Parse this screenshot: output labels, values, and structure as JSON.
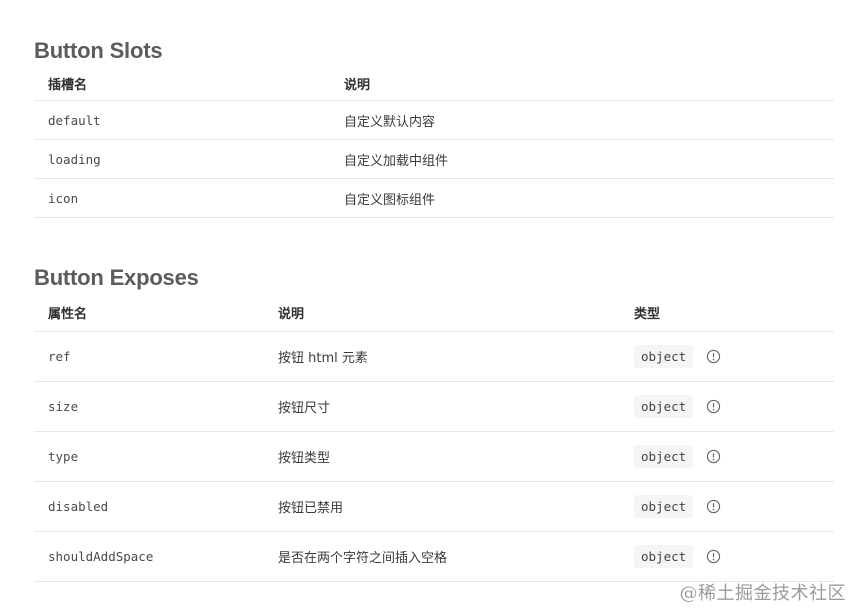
{
  "slots": {
    "title": "Button Slots",
    "headers": [
      "插槽名",
      "说明"
    ],
    "rows": [
      {
        "name": "default",
        "desc": "自定义默认内容"
      },
      {
        "name": "loading",
        "desc": "自定义加载中组件"
      },
      {
        "name": "icon",
        "desc": "自定义图标组件"
      }
    ]
  },
  "exposes": {
    "title": "Button Exposes",
    "headers": [
      "属性名",
      "说明",
      "类型"
    ],
    "rows": [
      {
        "name": "ref",
        "desc": "按钮 html 元素",
        "type": "object",
        "icon": "info-circle-icon"
      },
      {
        "name": "size",
        "desc": "按钮尺寸",
        "type": "object",
        "icon": "info-circle-icon"
      },
      {
        "name": "type",
        "desc": "按钮类型",
        "type": "object",
        "icon": "info-circle-icon"
      },
      {
        "name": "disabled",
        "desc": "按钮已禁用",
        "type": "object",
        "icon": "info-circle-icon"
      },
      {
        "name": "shouldAddSpace",
        "desc": "是否在两个字符之间插入空格",
        "type": "object",
        "icon": "info-circle-icon"
      }
    ]
  },
  "watermark": "@稀土掘金技术社区",
  "colors": {
    "title": "#5c5c5c",
    "border": "#e4e7ed",
    "tag_bg": "#f4f5f7",
    "watermark": "#9b9b9b"
  }
}
